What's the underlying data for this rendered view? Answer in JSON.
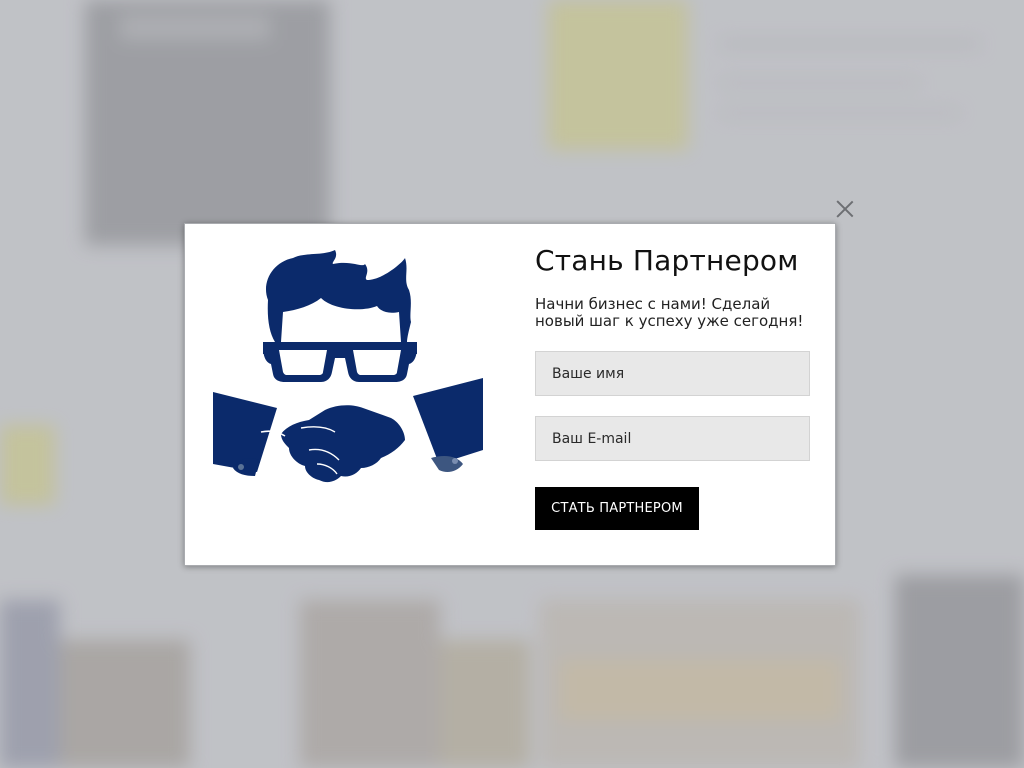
{
  "modal": {
    "title": "Стань Партнером",
    "subtitle": "Начни бизнес с нами! Сделай новый шаг к успеху уже сегодня!",
    "name_placeholder": "Ваше имя",
    "email_placeholder": "Ваш E-mail",
    "submit_label": "СТАТЬ ПАРТНЕРОМ",
    "illustration_icon": "partner-handshake-icon",
    "close_icon": "close-icon"
  },
  "colors": {
    "illustration": "#0b2a6b",
    "button": "#000000",
    "field_background": "#e8e8e8",
    "page_overlay": "#c4c6ca"
  }
}
